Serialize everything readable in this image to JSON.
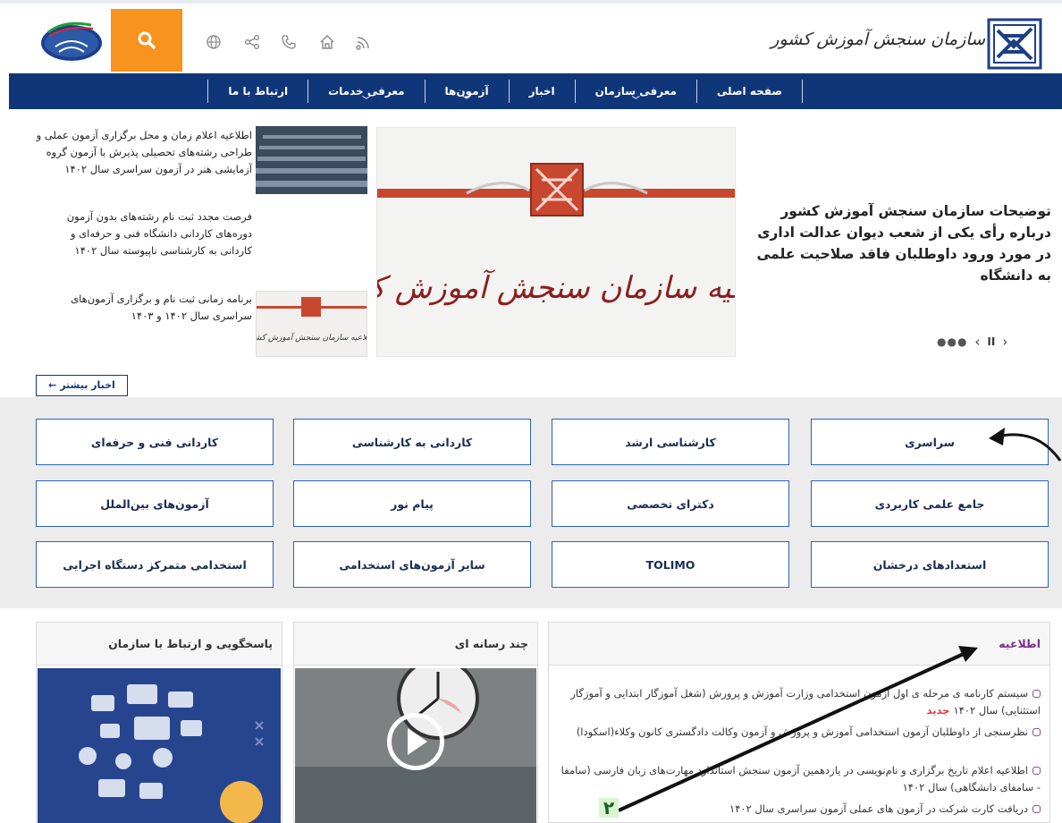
{
  "header": {
    "org_name": "سازمان سنجش آموزش کشور",
    "icons": [
      "rss-icon",
      "home-icon",
      "phone-icon",
      "share-icon",
      "globe-icon"
    ]
  },
  "nav": [
    {
      "label": "صفحه اصلی",
      "dropdown": false
    },
    {
      "label": "معرفی سازمان",
      "dropdown": true
    },
    {
      "label": "اخبار",
      "dropdown": false
    },
    {
      "label": "آزمون‌ها",
      "dropdown": true
    },
    {
      "label": "معرفی خدمات",
      "dropdown": true
    },
    {
      "label": "ارتباط با ما",
      "dropdown": false
    }
  ],
  "hero": {
    "text": "توضیحات سازمان سنجش آموزش کشور درباره رأی یکی از شعب دیوان عدالت اداری در مورد ورود داوطلبان فاقد صلاحیت علمی به دانشگاه",
    "image_caption": "اطلاعیه سازمان سنجش آموزش کشور"
  },
  "slider": {
    "next": "‹",
    "pause": "II",
    "prev": "›",
    "dots": "●●●"
  },
  "side_news": [
    "اطلاعیه اعلام زمان و محل برگزاری آزمون عملی و طراحی رشته‌های تحصیلی پذیرش با آزمون گروه آزمایشی هنر در آزمون سراسری سال ۱۴۰۲",
    "فرصت مجدد ثبت نام رشته‌های بدون آزمون دوره‌های کاردانی دانشگاه فنی و حرفه‌ای و کاردانی به کارشناسی ناپیوسته سال ۱۴۰۲",
    "برنامه زمانی ثبت نام و برگزاری آزمون‌های سراسری سال ۱۴۰۲ و ۱۴۰۳"
  ],
  "thumb3_caption": "اطلاعیه سازمان سنجش آموزش کشور",
  "more_news": "اخبار بیشتر ←",
  "exams": {
    "row1": [
      "سراسری",
      "کارشناسی ارشد",
      "کاردانی به کارشناسی",
      "کاردانی فنی و حرفه‌ای"
    ],
    "row2": [
      "جامع علمی کاربردی",
      "دکترای تخصصی",
      "پیام نور",
      "آزمون‌های بین‌الملل"
    ],
    "row3": [
      "استعدادهای درخشان",
      "TOLIMO",
      "سایر آزمون‌های استخدامی",
      "استخدامی متمرکز دستگاه اجرایی"
    ]
  },
  "panels": {
    "contact_title": "پاسخگویی و ارتباط با سازمان",
    "media_title": "چند رسانه ای",
    "notice_title": "اطلاعیه"
  },
  "notices": [
    {
      "text": "سیستم کارنامه ی مرحله ی اول آزمون استخدامی وزارت آموزش و پرورش (شغل آموزگار ابتدایی و آموزگار استثنایی) سال ۱۴۰۲",
      "badge": "جدید"
    },
    {
      "text": "نظرسنجی از داوطلبان آزمون استخدامی آموزش و پرورش و آزمون وکالت دادگستری کانون وکلاء(اسکودا)",
      "badge": ""
    },
    {
      "text": "اطلاعیه اعلام تاریخ برگزاری و نام‌نویسی در یازدهمین آزمون سنجش استاندارد مهارت‌های زبان فارسی (سامفا - سامفای دانشگاهی) سال ۱۴۰۲",
      "badge": ""
    },
    {
      "text": "دریافت کارت شرکت در آزمون های عملی آزمون سراسری سال ۱۴۰۲",
      "badge": ""
    }
  ],
  "annotation_number": "۲"
}
